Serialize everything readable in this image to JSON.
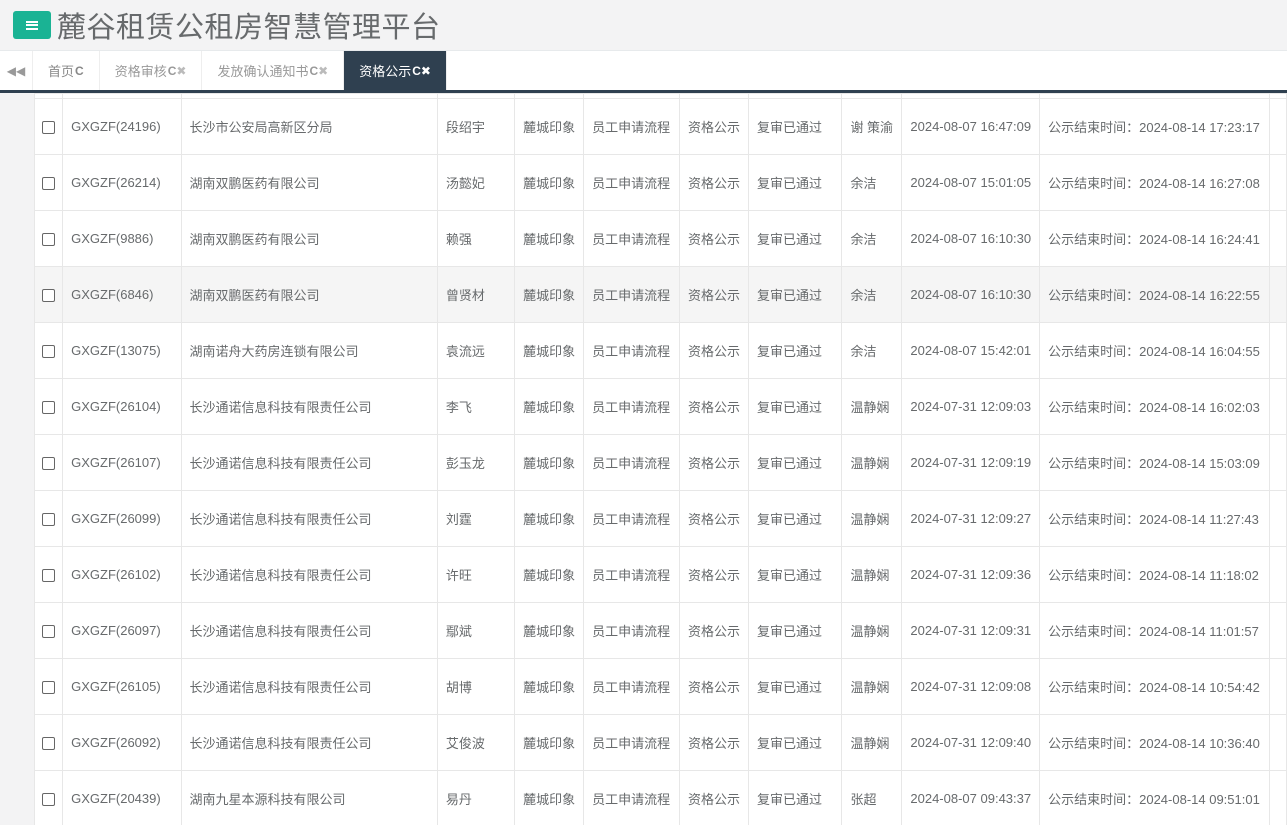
{
  "header": {
    "title": "麓谷租赁公租房智慧管理平台",
    "menu_icon": "bars-icon"
  },
  "tabs": [
    {
      "label": "首页",
      "closable": false
    },
    {
      "label": "资格审核",
      "closable": true
    },
    {
      "label": "发放确认通知书",
      "closable": true
    },
    {
      "label": "资格公示",
      "closable": true,
      "active": true
    }
  ],
  "colors": {
    "accent": "#1ab394",
    "active_tab": "#2f4050"
  },
  "rows": [
    {
      "code": "GXGZF(24196)",
      "company": "长沙市公安局高新区分局",
      "name": "段绍宇",
      "project": "麓城印象",
      "flow": "员工申请流程",
      "stage": "资格公示",
      "status": "复审已通过",
      "reviewer": "谢 策渝",
      "date": "2024-08-07 16:47:09",
      "end": "公示结束时间：2024-08-14 17:23:17"
    },
    {
      "code": "GXGZF(26214)",
      "company": "湖南双鹏医药有限公司",
      "name": "汤懿妃",
      "project": "麓城印象",
      "flow": "员工申请流程",
      "stage": "资格公示",
      "status": "复审已通过",
      "reviewer": "余洁",
      "date": "2024-08-07 15:01:05",
      "end": "公示结束时间：2024-08-14 16:27:08"
    },
    {
      "code": "GXGZF(9886)",
      "company": "湖南双鹏医药有限公司",
      "name": "赖强",
      "project": "麓城印象",
      "flow": "员工申请流程",
      "stage": "资格公示",
      "status": "复审已通过",
      "reviewer": "余洁",
      "date": "2024-08-07 16:10:30",
      "end": "公示结束时间：2024-08-14 16:24:41"
    },
    {
      "code": "GXGZF(6846)",
      "company": "湖南双鹏医药有限公司",
      "name": "曾贤材",
      "project": "麓城印象",
      "flow": "员工申请流程",
      "stage": "资格公示",
      "status": "复审已通过",
      "reviewer": "余洁",
      "date": "2024-08-07 16:10:30",
      "end": "公示结束时间：2024-08-14 16:22:55"
    },
    {
      "code": "GXGZF(13075)",
      "company": "湖南诺舟大药房连锁有限公司",
      "name": "袁流远",
      "project": "麓城印象",
      "flow": "员工申请流程",
      "stage": "资格公示",
      "status": "复审已通过",
      "reviewer": "余洁",
      "date": "2024-08-07 15:42:01",
      "end": "公示结束时间：2024-08-14 16:04:55"
    },
    {
      "code": "GXGZF(26104)",
      "company": "长沙通诺信息科技有限责任公司",
      "name": "李飞",
      "project": "麓城印象",
      "flow": "员工申请流程",
      "stage": "资格公示",
      "status": "复审已通过",
      "reviewer": "温静娴",
      "date": "2024-07-31 12:09:03",
      "end": "公示结束时间：2024-08-14 16:02:03"
    },
    {
      "code": "GXGZF(26107)",
      "company": "长沙通诺信息科技有限责任公司",
      "name": "彭玉龙",
      "project": "麓城印象",
      "flow": "员工申请流程",
      "stage": "资格公示",
      "status": "复审已通过",
      "reviewer": "温静娴",
      "date": "2024-07-31 12:09:19",
      "end": "公示结束时间：2024-08-14 15:03:09"
    },
    {
      "code": "GXGZF(26099)",
      "company": "长沙通诺信息科技有限责任公司",
      "name": "刘霆",
      "project": "麓城印象",
      "flow": "员工申请流程",
      "stage": "资格公示",
      "status": "复审已通过",
      "reviewer": "温静娴",
      "date": "2024-07-31 12:09:27",
      "end": "公示结束时间：2024-08-14 11:27:43"
    },
    {
      "code": "GXGZF(26102)",
      "company": "长沙通诺信息科技有限责任公司",
      "name": "许旺",
      "project": "麓城印象",
      "flow": "员工申请流程",
      "stage": "资格公示",
      "status": "复审已通过",
      "reviewer": "温静娴",
      "date": "2024-07-31 12:09:36",
      "end": "公示结束时间：2024-08-14 11:18:02"
    },
    {
      "code": "GXGZF(26097)",
      "company": "长沙通诺信息科技有限责任公司",
      "name": "鄢斌",
      "project": "麓城印象",
      "flow": "员工申请流程",
      "stage": "资格公示",
      "status": "复审已通过",
      "reviewer": "温静娴",
      "date": "2024-07-31 12:09:31",
      "end": "公示结束时间：2024-08-14 11:01:57"
    },
    {
      "code": "GXGZF(26105)",
      "company": "长沙通诺信息科技有限责任公司",
      "name": "胡博",
      "project": "麓城印象",
      "flow": "员工申请流程",
      "stage": "资格公示",
      "status": "复审已通过",
      "reviewer": "温静娴",
      "date": "2024-07-31 12:09:08",
      "end": "公示结束时间：2024-08-14 10:54:42"
    },
    {
      "code": "GXGZF(26092)",
      "company": "长沙通诺信息科技有限责任公司",
      "name": "艾俊波",
      "project": "麓城印象",
      "flow": "员工申请流程",
      "stage": "资格公示",
      "status": "复审已通过",
      "reviewer": "温静娴",
      "date": "2024-07-31 12:09:40",
      "end": "公示结束时间：2024-08-14 10:36:40"
    },
    {
      "code": "GXGZF(20439)",
      "company": "湖南九星本源科技有限公司",
      "name": "易丹",
      "project": "麓城印象",
      "flow": "员工申请流程",
      "stage": "资格公示",
      "status": "复审已通过",
      "reviewer": "张超",
      "date": "2024-08-07 09:43:37",
      "end": "公示结束时间：2024-08-14 09:51:01"
    }
  ]
}
